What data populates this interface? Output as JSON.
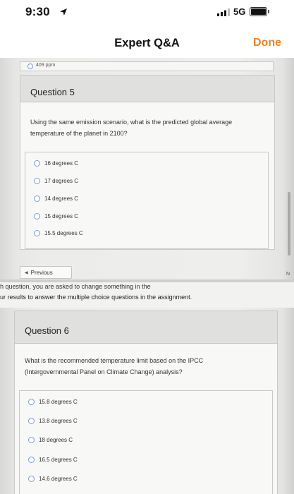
{
  "status_bar": {
    "time": "9:30",
    "network": "5G",
    "icons": [
      "location-arrow-icon",
      "signal-bars-icon",
      "battery-icon"
    ]
  },
  "nav": {
    "title": "Expert Q&A",
    "done_label": "Done",
    "accent_color": "#e8842a"
  },
  "top_option": {
    "label": "409 ppm"
  },
  "question5": {
    "title": "Question 5",
    "text_line1": "Using the same emission scenario, what is the predicted global average",
    "text_line2": "temperature of the planet in 2100?",
    "options": [
      "16 degrees C",
      "17 degrees C",
      "14 degrees C",
      "15 degrees C",
      "15.5 degrees C"
    ]
  },
  "previous_label": "Previous",
  "next_peek": "N",
  "instructions": {
    "line1": "h question, you are asked to change something in the",
    "line2": "ur results to answer the multiple choice questions in the assignment."
  },
  "question6": {
    "title": "Question 6",
    "text_line1": "What is the recommended temperature limit based on the IPCC",
    "text_line2": "(Intergovernmental Panel on Climate Change) analysis?",
    "options": [
      "15.8 degrees C",
      "13.8 degrees C",
      "18 degrees C",
      "16.5 degrees C",
      "14.6 degrees C"
    ]
  }
}
